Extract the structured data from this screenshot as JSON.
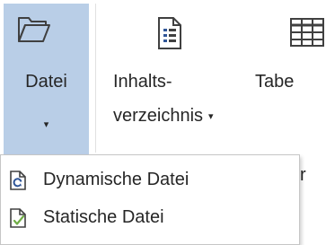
{
  "ribbon": {
    "datei_button": {
      "label": "Datei",
      "icon": "folder-icon",
      "dropdown_glyph": "▾"
    },
    "toc_button": {
      "label_line1": "Inhalts-",
      "label_line2": "verzeichnis",
      "dropdown_glyph": "▾",
      "icon": "document-icon"
    },
    "table_button": {
      "label": "Tabe",
      "icon": "table-icon"
    }
  },
  "menu": {
    "items": [
      {
        "label": "Dynamische Datei",
        "icon": "dynamic-file-icon"
      },
      {
        "label": "Statische Datei",
        "icon": "static-file-icon"
      }
    ]
  },
  "colors": {
    "selected_button_bg": "#b9cee7",
    "icon_blue": "#2f5597",
    "icon_green": "#70ad47",
    "text": "#262626"
  },
  "partial_text": "r"
}
